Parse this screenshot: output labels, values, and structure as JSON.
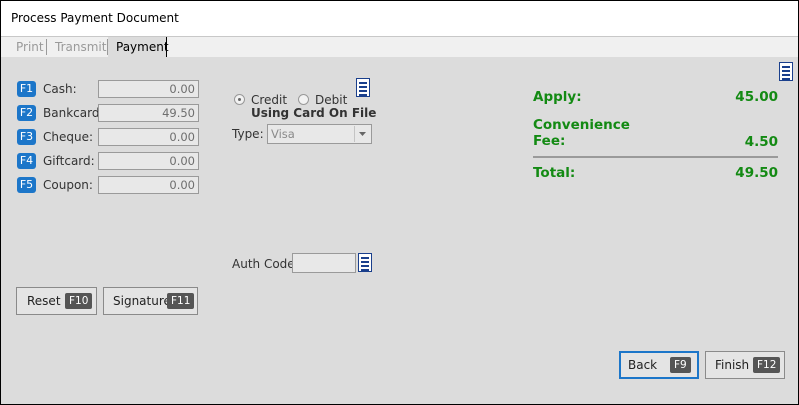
{
  "window": {
    "title": "Process Payment Document"
  },
  "tabs": [
    {
      "label": "Print",
      "active": false
    },
    {
      "label": "Transmit",
      "active": false
    },
    {
      "label": "Payment",
      "active": true
    }
  ],
  "tenders": [
    {
      "key": "F1",
      "label": "Cash:",
      "value": "0.00"
    },
    {
      "key": "F2",
      "label": "Bankcard:",
      "value": "49.50"
    },
    {
      "key": "F3",
      "label": "Cheque:",
      "value": "0.00"
    },
    {
      "key": "F4",
      "label": "Giftcard:",
      "value": "0.00"
    },
    {
      "key": "F5",
      "label": "Coupon:",
      "value": "0.00"
    }
  ],
  "card": {
    "credit_label": "Credit",
    "debit_label": "Debit",
    "selected": "Credit",
    "on_file_label": "Using Card On File",
    "type_label": "Type:",
    "type_value": "Visa",
    "auth_label": "Auth Code:",
    "auth_value": ""
  },
  "summary": {
    "apply_label": "Apply:",
    "apply_value": "45.00",
    "fee_label_1": "Convenience",
    "fee_label_2": "Fee:",
    "fee_value": "4.50",
    "total_label": "Total:",
    "total_value": "49.50"
  },
  "buttons": {
    "reset": {
      "label": "Reset",
      "key": "F10"
    },
    "signature": {
      "label": "Signature",
      "key": "F11"
    },
    "back": {
      "label": "Back",
      "key": "F9"
    },
    "finish": {
      "label": "Finish",
      "key": "F12"
    }
  },
  "colors": {
    "accent_blue": "#1c76c9",
    "total_green": "#138a13",
    "icon_blue": "#1a3f8c"
  }
}
